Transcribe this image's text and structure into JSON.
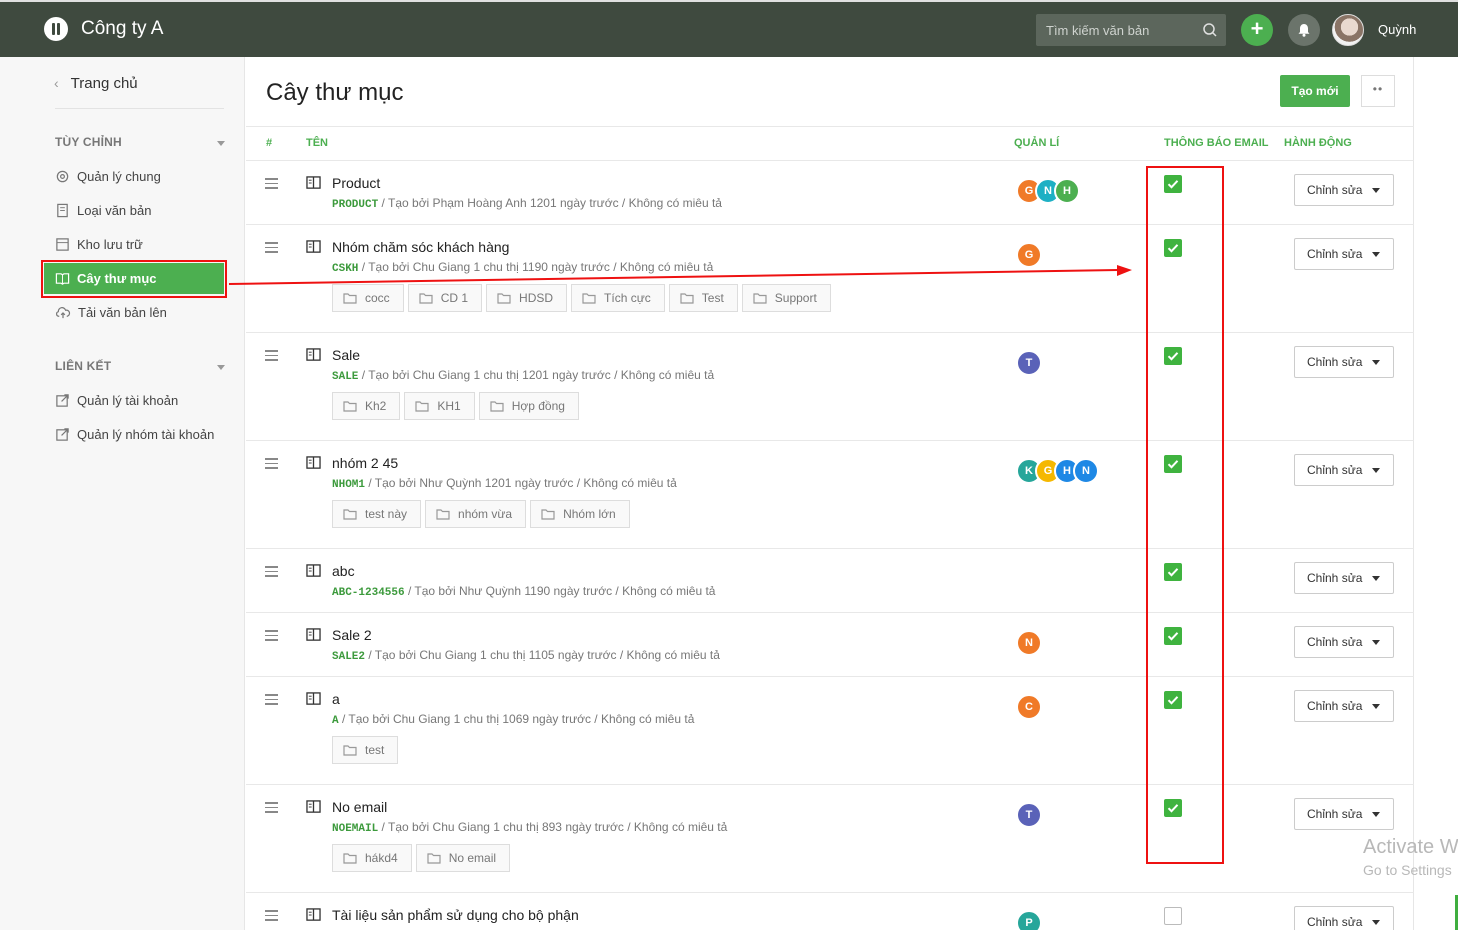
{
  "topbar": {
    "brand": "Công ty A",
    "search_placeholder": "Tìm kiếm văn bản",
    "user_name": "Quỳnh",
    "plus_label": "+"
  },
  "sidebar": {
    "home_label": "Trang chủ",
    "section_custom": "TÙY CHỈNH",
    "custom_items": [
      {
        "label": "Quản lý chung",
        "icon": "gear-icon"
      },
      {
        "label": "Loại văn bản",
        "icon": "document-icon"
      },
      {
        "label": "Kho lưu trữ",
        "icon": "archive-icon"
      },
      {
        "label": "Cây thư mục",
        "icon": "book-icon"
      },
      {
        "label": "Tải văn bản lên",
        "icon": "cloud-upload-icon"
      }
    ],
    "section_links": "LIÊN KẾT",
    "link_items": [
      {
        "label": "Quản lý tài khoản",
        "icon": "external-link-icon"
      },
      {
        "label": "Quản lý nhóm tài khoản",
        "icon": "external-link-icon"
      }
    ]
  },
  "main": {
    "title": "Cây thư mục",
    "create_label": "Tạo mới",
    "more_label": "••",
    "columns": {
      "index": "#",
      "name": "TÊN",
      "managers": "QUẢN LÍ",
      "email": "THÔNG BÁO EMAIL",
      "actions": "HÀNH ĐỘNG"
    },
    "edit_label": "Chỉnh sửa",
    "rows": [
      {
        "name": "Product",
        "code": "PRODUCT",
        "meta": " / Tạo bởi Phạm Hoàng Anh 1201 ngày trước / Không có miêu tả",
        "chips": [],
        "managers": [
          {
            "letter": "G",
            "color": "#f07a28"
          },
          {
            "letter": "N",
            "color": "#1eb0c4"
          },
          {
            "letter": "H",
            "color": "#4caf50"
          }
        ],
        "email": true
      },
      {
        "name": "Nhóm chăm sóc khách hàng",
        "code": "CSKH",
        "meta": " / Tạo bởi Chu Giang 1 chu thị 1190 ngày trước / Không có miêu tả",
        "chips": [
          "cocc",
          "CD 1",
          "HDSD",
          "Tích cực",
          "Test",
          "Support"
        ],
        "managers": [
          {
            "letter": "G",
            "color": "#f07a28"
          }
        ],
        "email": true
      },
      {
        "name": "Sale",
        "code": "SALE",
        "meta": " / Tạo bởi Chu Giang 1 chu thị 1201 ngày trước / Không có miêu tả",
        "chips": [
          "Kh2",
          "KH1",
          "Hợp đồng"
        ],
        "managers": [
          {
            "letter": "T",
            "color": "#5a62b8"
          }
        ],
        "email": true
      },
      {
        "name": "nhóm 2 45",
        "code": "NHOM1",
        "meta": " / Tạo bởi Như Quỳnh 1201 ngày trước / Không có miêu tả",
        "chips": [
          "test này",
          "nhóm vừa",
          "Nhóm lớn"
        ],
        "managers": [
          {
            "letter": "K",
            "color": "#26a69a"
          },
          {
            "letter": "G",
            "color": "#f5b800"
          },
          {
            "letter": "H",
            "color": "#1e88e5"
          },
          {
            "letter": "N",
            "color": "#1e88e5"
          }
        ],
        "email": true
      },
      {
        "name": "abc",
        "code": "ABC-1234556",
        "meta": " / Tạo bởi Như Quỳnh 1190 ngày trước / Không có miêu tả",
        "chips": [],
        "managers": [],
        "email": true
      },
      {
        "name": "Sale 2",
        "code": "SALE2",
        "meta": " / Tạo bởi Chu Giang 1 chu thị 1105 ngày trước / Không có miêu tả",
        "chips": [],
        "managers": [
          {
            "letter": "N",
            "color": "#f07a28"
          }
        ],
        "email": true
      },
      {
        "name": "a",
        "code": "A",
        "meta": " / Tạo bởi Chu Giang 1 chu thị 1069 ngày trước / Không có miêu tả",
        "chips": [
          "test"
        ],
        "managers": [
          {
            "letter": "C",
            "color": "#f07a28"
          }
        ],
        "email": true
      },
      {
        "name": "No email",
        "code": "NOEMAIL",
        "meta": " / Tạo bởi Chu Giang 1 chu thị 893 ngày trước / Không có miêu tả",
        "chips": [
          "hákd4",
          "No email"
        ],
        "managers": [
          {
            "letter": "T",
            "color": "#5a62b8"
          }
        ],
        "email": true
      },
      {
        "name": "Tài liệu sản phẩm sử dụng cho bộ phận",
        "code": "",
        "meta": "",
        "chips": [],
        "managers": [
          {
            "letter": "P",
            "color": "#26a69a"
          }
        ],
        "email": false
      }
    ]
  },
  "overlay": {
    "watermark_title": "Activate W",
    "watermark_sub": "Go to Settings",
    "annotation_color": "#ee1111"
  }
}
